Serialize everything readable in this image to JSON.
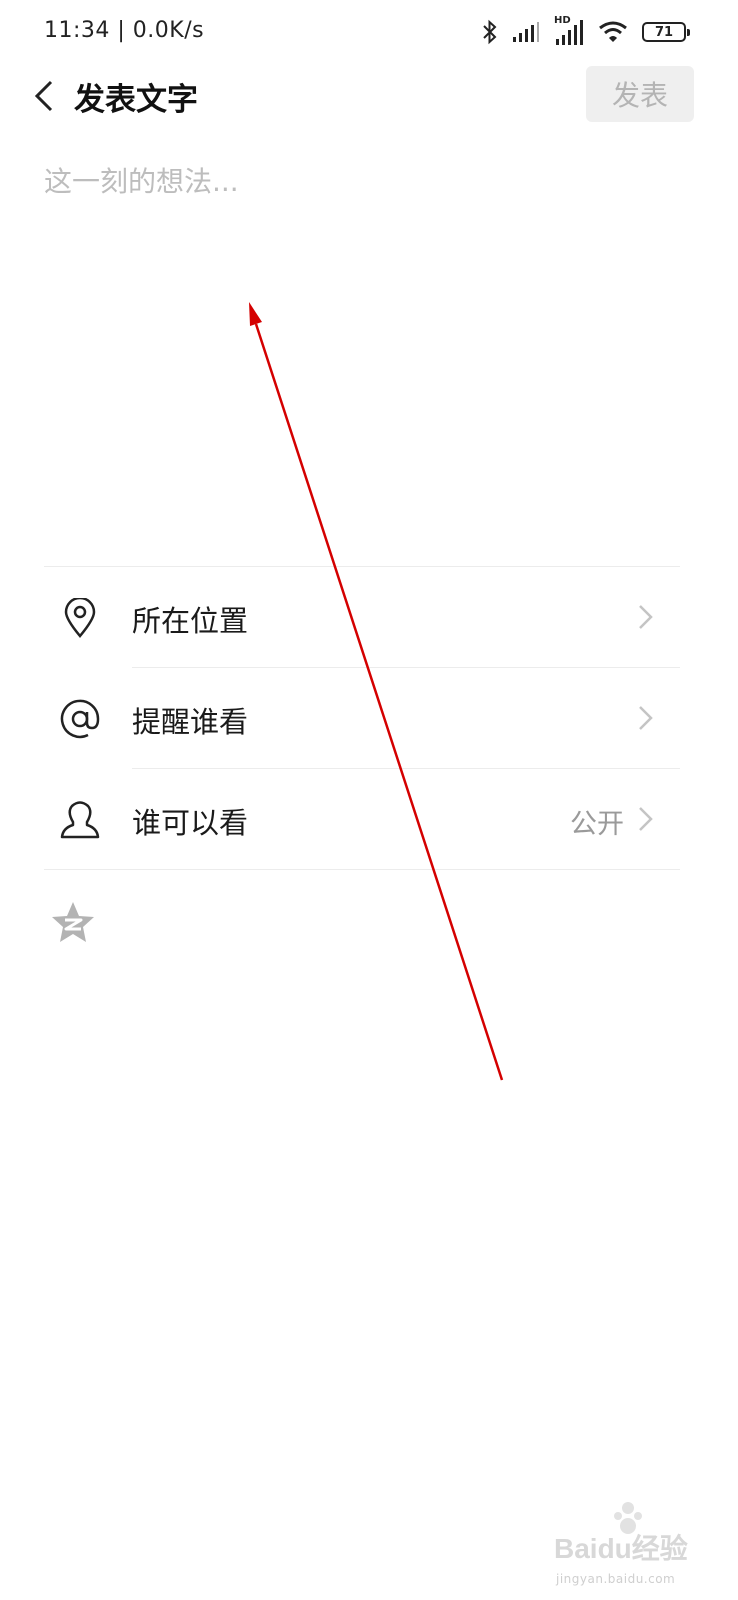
{
  "status_bar": {
    "time_speed": "11:34 | 0.0K/s",
    "hd_label": "HD",
    "battery": "71",
    "icons": [
      "bluetooth-icon",
      "signal-icon",
      "hd-signal-icon",
      "wifi-icon",
      "battery-icon"
    ]
  },
  "header": {
    "title": "发表文字",
    "post_label": "发表"
  },
  "compose": {
    "placeholder": "这一刻的想法...",
    "value": ""
  },
  "options": [
    {
      "label": "所在位置",
      "icon": "location-pin-icon"
    },
    {
      "label": "提醒谁看",
      "icon": "at-sign-icon"
    },
    {
      "label": "谁可以看",
      "icon": "person-icon",
      "value": "公开"
    }
  ],
  "qzone": {
    "icon": "qzone-star-icon"
  },
  "watermark": {
    "main": "Baidu经验",
    "sub": "jingyan.baidu.com"
  },
  "colors": {
    "annotation_arrow": "#d40000",
    "disabled_button_bg": "#efefef",
    "disabled_button_text": "#b4b4b4",
    "placeholder": "#bdbdbd"
  }
}
